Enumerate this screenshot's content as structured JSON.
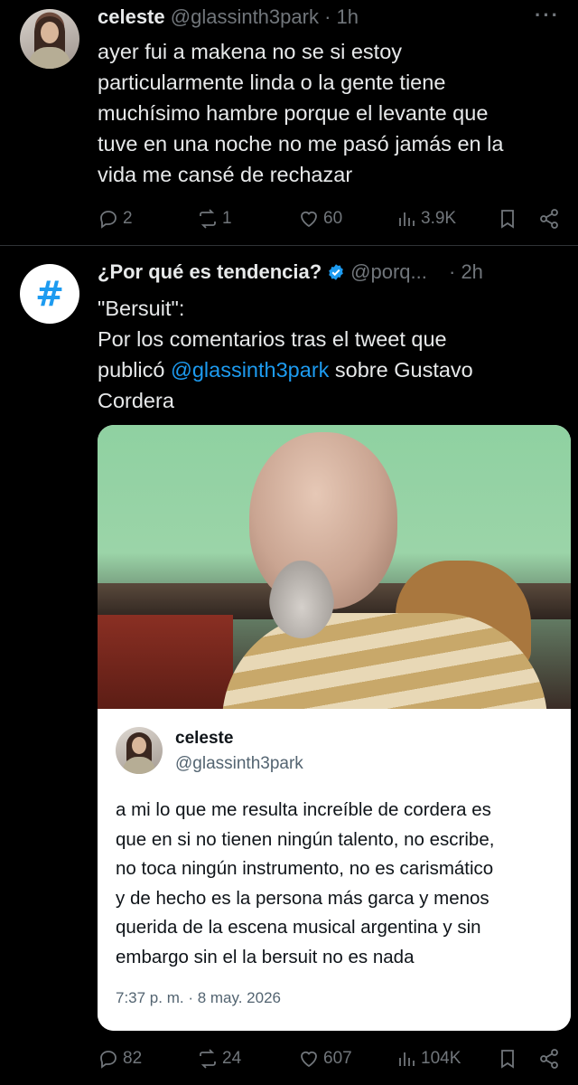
{
  "tweet1": {
    "name": "celeste",
    "handle": "@glassinth3park",
    "time": "· 1h",
    "more": "···",
    "text_lines": [
      "ayer fui a makena no se si estoy",
      "particularmente linda o la gente tiene",
      "muchísimo hambre porque el levante que",
      "tuve en una noche no me pasó jamás en la",
      "vida me cansé de rechazar"
    ],
    "replies": "2",
    "reposts": "1",
    "likes": "60",
    "views": "3.9K"
  },
  "tweet2": {
    "avatar_symbol": "#",
    "name": "¿Por qué es tendencia?",
    "handle": "@porq...",
    "time": "· 2h",
    "title": "\"Bersuit\":",
    "text_line1": "Por los comentarios tras el tweet que",
    "text_line2_pre": "publicó ",
    "mention": "@glassinth3park",
    "text_line2_post": " sobre Gustavo",
    "text_line3": "Cordera",
    "quote": {
      "name": "celeste",
      "handle": "@glassinth3park",
      "text_lines": [
        "a mi lo que me resulta increíble de cordera es",
        "que en si no tienen ningún talento, no escribe,",
        "no toca ningún instrumento, no es carismático",
        "y de hecho es la persona más garca y menos",
        "querida de la escena musical argentina y sin",
        "embargo sin el la bersuit no es nada"
      ],
      "timestamp": "7:37 p. m. · 8 may. 2026"
    },
    "replies": "82",
    "reposts": "24",
    "likes": "607",
    "views": "104K"
  },
  "colors": {
    "background": "#000000",
    "text": "#e7e9ea",
    "muted": "#71767b",
    "accent": "#1d9bf0"
  }
}
